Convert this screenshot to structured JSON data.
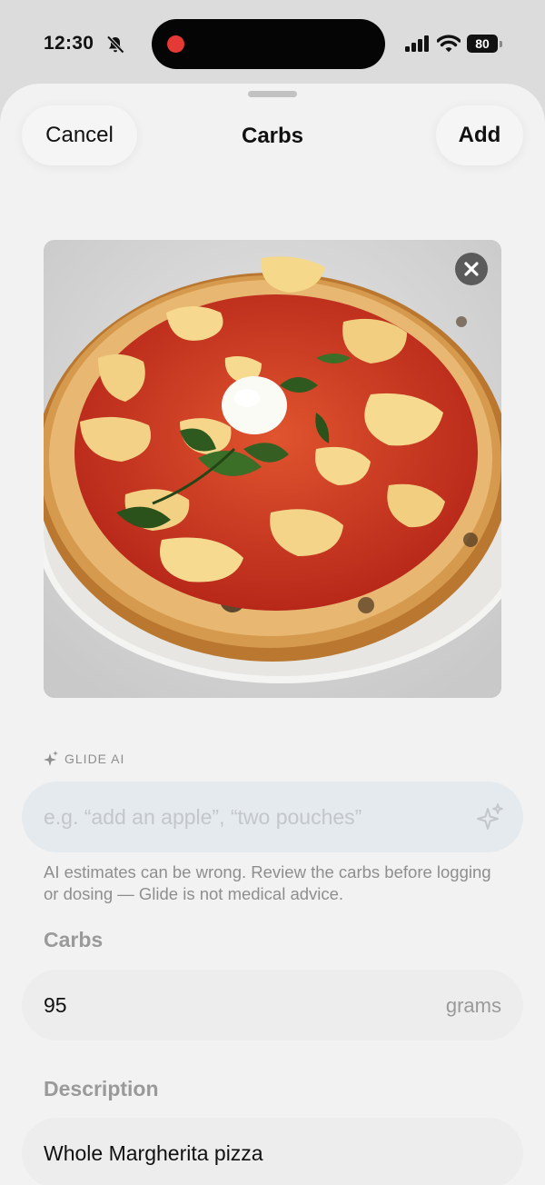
{
  "status_bar": {
    "time": "12:30",
    "battery": "80",
    "icons": [
      "bell-slash-icon",
      "recording-dot-icon",
      "cellular-signal-icon",
      "wifi-icon",
      "battery-icon"
    ],
    "recording_color": "#e53935"
  },
  "sheet": {
    "title": "Carbs",
    "cancel_label": "Cancel",
    "add_label": "Add"
  },
  "photo": {
    "subject": "pizza-photo",
    "remove_icon": "close-icon"
  },
  "ai": {
    "label": "GLIDE AI",
    "icon": "sparkle-icon",
    "input_value": "",
    "placeholder": "e.g. “add an apple”, “two pouches”",
    "disclaimer": "AI estimates can be wrong. Review the carbs before logging or dosing — Glide is not medical advice."
  },
  "carbs": {
    "label": "Carbs",
    "value": "95",
    "unit": "grams"
  },
  "description": {
    "label": "Description",
    "value": "Whole Margherita pizza"
  },
  "colors": {
    "sheet_background": "#f2f2f2",
    "ai_field_background": "#e5eaee",
    "secondary_text": "#8e8e8e"
  }
}
